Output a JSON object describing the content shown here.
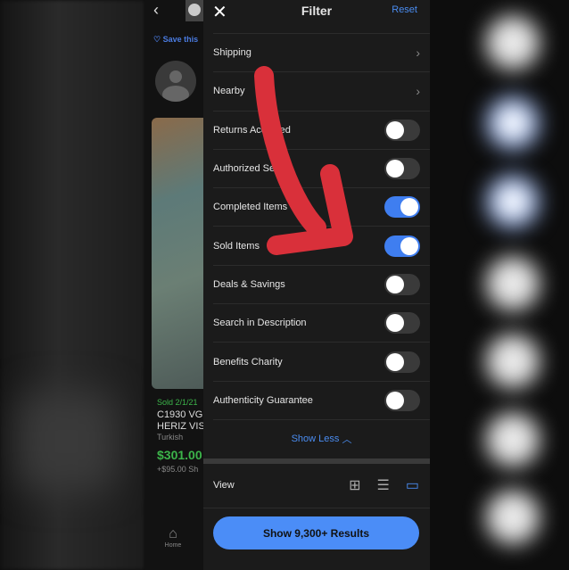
{
  "left_panel": {
    "save_label": "Save this",
    "sold_date": "Sold 2/1/21",
    "item_title_1": "C1930 VG",
    "item_title_2": "HERIZ VIS",
    "item_subtitle": "Turkish",
    "price": "$301.00",
    "shipping": "+$95.00 Sh",
    "home_label": "Home"
  },
  "filter": {
    "title": "Filter",
    "reset_label": "Reset",
    "rows": [
      {
        "label": "Shipping",
        "type": "nav"
      },
      {
        "label": "Nearby",
        "type": "nav"
      },
      {
        "label": "Returns Accepted",
        "type": "toggle",
        "on": false
      },
      {
        "label": "Authorized Seller",
        "type": "toggle",
        "on": false
      },
      {
        "label": "Completed Items",
        "type": "toggle",
        "on": true
      },
      {
        "label": "Sold Items",
        "type": "toggle",
        "on": true
      },
      {
        "label": "Deals & Savings",
        "type": "toggle",
        "on": false
      },
      {
        "label": "Search in Description",
        "type": "toggle",
        "on": false
      },
      {
        "label": "Benefits Charity",
        "type": "toggle",
        "on": false
      },
      {
        "label": "Authenticity Guarantee",
        "type": "toggle",
        "on": false
      }
    ],
    "show_less_label": "Show Less",
    "view_label": "View",
    "view_selected": "gallery",
    "show_results_label": "Show 9,300+ Results"
  },
  "colors": {
    "accent": "#4b8df7",
    "sold_green": "#3cb44a",
    "arrow": "#d9303a"
  }
}
